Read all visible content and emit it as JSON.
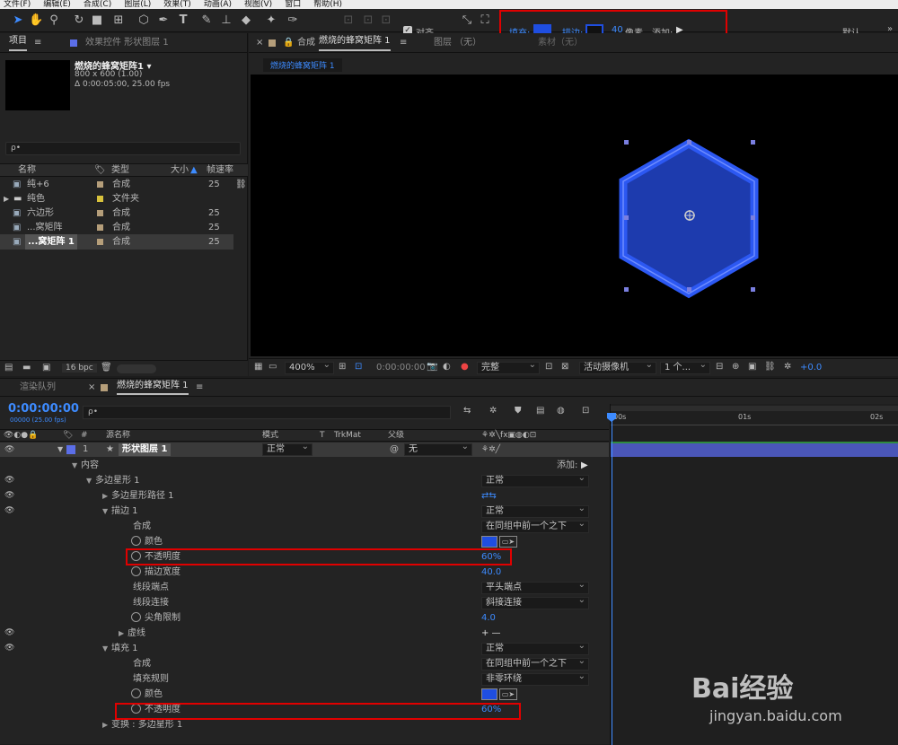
{
  "menu": [
    "文件(F)",
    "编辑(E)",
    "合成(C)",
    "图层(L)",
    "效果(T)",
    "动画(A)",
    "视图(V)",
    "窗口",
    "帮助(H)"
  ],
  "toolbar": {
    "align_label": "对齐",
    "fill_label": "填充:",
    "stroke_label": "描边:",
    "stroke_width": "40",
    "stroke_unit": "像素",
    "add_label": "添加:",
    "workspace": "默认",
    "fill_color": "#1f4ee0"
  },
  "project": {
    "tab_label": "项目",
    "effects_tab": "效果控件 形状图层 1",
    "comp_name": "燃烧的蜂窝矩阵1 ▾",
    "comp_size": "800 x 600 (1.00)",
    "comp_duration": "Δ 0:00:05:00, 25.00 fps",
    "search_placeholder": "ρ•",
    "col_name": "名称",
    "col_type": "类型",
    "col_size": "大小",
    "col_fps": "帧速率",
    "items": [
      {
        "name": "纯+6",
        "type": "合成",
        "fps": "25",
        "color": "#b59e7a"
      },
      {
        "name": "纯色",
        "type": "文件夹",
        "fps": "",
        "color": "#d8c23c"
      },
      {
        "name": "六边形",
        "type": "合成",
        "fps": "25",
        "color": "#b59e7a"
      },
      {
        "name": "...窝矩阵",
        "type": "合成",
        "fps": "25",
        "color": "#b59e7a"
      },
      {
        "name": "...窝矩阵 1",
        "type": "合成",
        "fps": "25",
        "color": "#b59e7a"
      }
    ],
    "bpc": "16 bpc"
  },
  "viewer": {
    "tab_comp": "合成",
    "tab_comp_name": "燃烧的蜂窝矩阵 1",
    "layer_tab": "图层 （无）",
    "footage_tab": "素材（无）",
    "crumb": "燃烧的蜂窝矩阵 1",
    "zoom": "400%",
    "timecode": "0:00:00:00",
    "quality": "完整",
    "camera": "活动摄像机",
    "views": "1 个...",
    "exposure": "+0.0"
  },
  "timeline": {
    "render_tab": "渲染队列",
    "comp_tab": "燃烧的蜂窝矩阵 1",
    "timecode": "0:00:00:00",
    "fps_info": "00000 (25.00 fps)",
    "search_placeholder": "ρ•",
    "col_num": "#",
    "col_source": "源名称",
    "col_mode": "模式",
    "col_t": "T",
    "col_trkmat": "TrkMat",
    "col_parent": "父级",
    "ruler": [
      "00s",
      "01s",
      "02s"
    ],
    "layer": {
      "num": "1",
      "name": "形状图层 1",
      "mode": "正常",
      "parent": "无"
    },
    "add_label": "添加:",
    "props": [
      {
        "label": "内容",
        "value": "",
        "dd": false
      },
      {
        "label": "多边星形 1",
        "value": "正常",
        "dd": true
      },
      {
        "label": "多边星形路径 1",
        "value": "",
        "dd": false
      },
      {
        "label": "描边 1",
        "value": "正常",
        "dd": true
      },
      {
        "label": "合成",
        "value": "在同组中前一个之下",
        "dd": true
      },
      {
        "label": "颜色",
        "value": "",
        "dd": false
      },
      {
        "label": "不透明度",
        "value": "60%",
        "dd": false
      },
      {
        "label": "描边宽度",
        "value": "40.0",
        "dd": false
      },
      {
        "label": "线段端点",
        "value": "平头端点",
        "dd": true
      },
      {
        "label": "线段连接",
        "value": "斜接连接",
        "dd": true
      },
      {
        "label": "尖角限制",
        "value": "4.0",
        "dd": false
      },
      {
        "label": "虚线",
        "value": "+ —",
        "dd": false
      },
      {
        "label": "填充 1",
        "value": "正常",
        "dd": true
      },
      {
        "label": "合成",
        "value": "在同组中前一个之下",
        "dd": true
      },
      {
        "label": "填充规则",
        "value": "非零环绕",
        "dd": true
      },
      {
        "label": "颜色",
        "value": "",
        "dd": false
      },
      {
        "label": "不透明度",
        "value": "60%",
        "dd": false
      },
      {
        "label": "变换 : 多边星形 1",
        "value": "",
        "dd": false
      }
    ]
  },
  "watermark": {
    "brand": "Bai经验",
    "url": "jingyan.baidu.com"
  }
}
